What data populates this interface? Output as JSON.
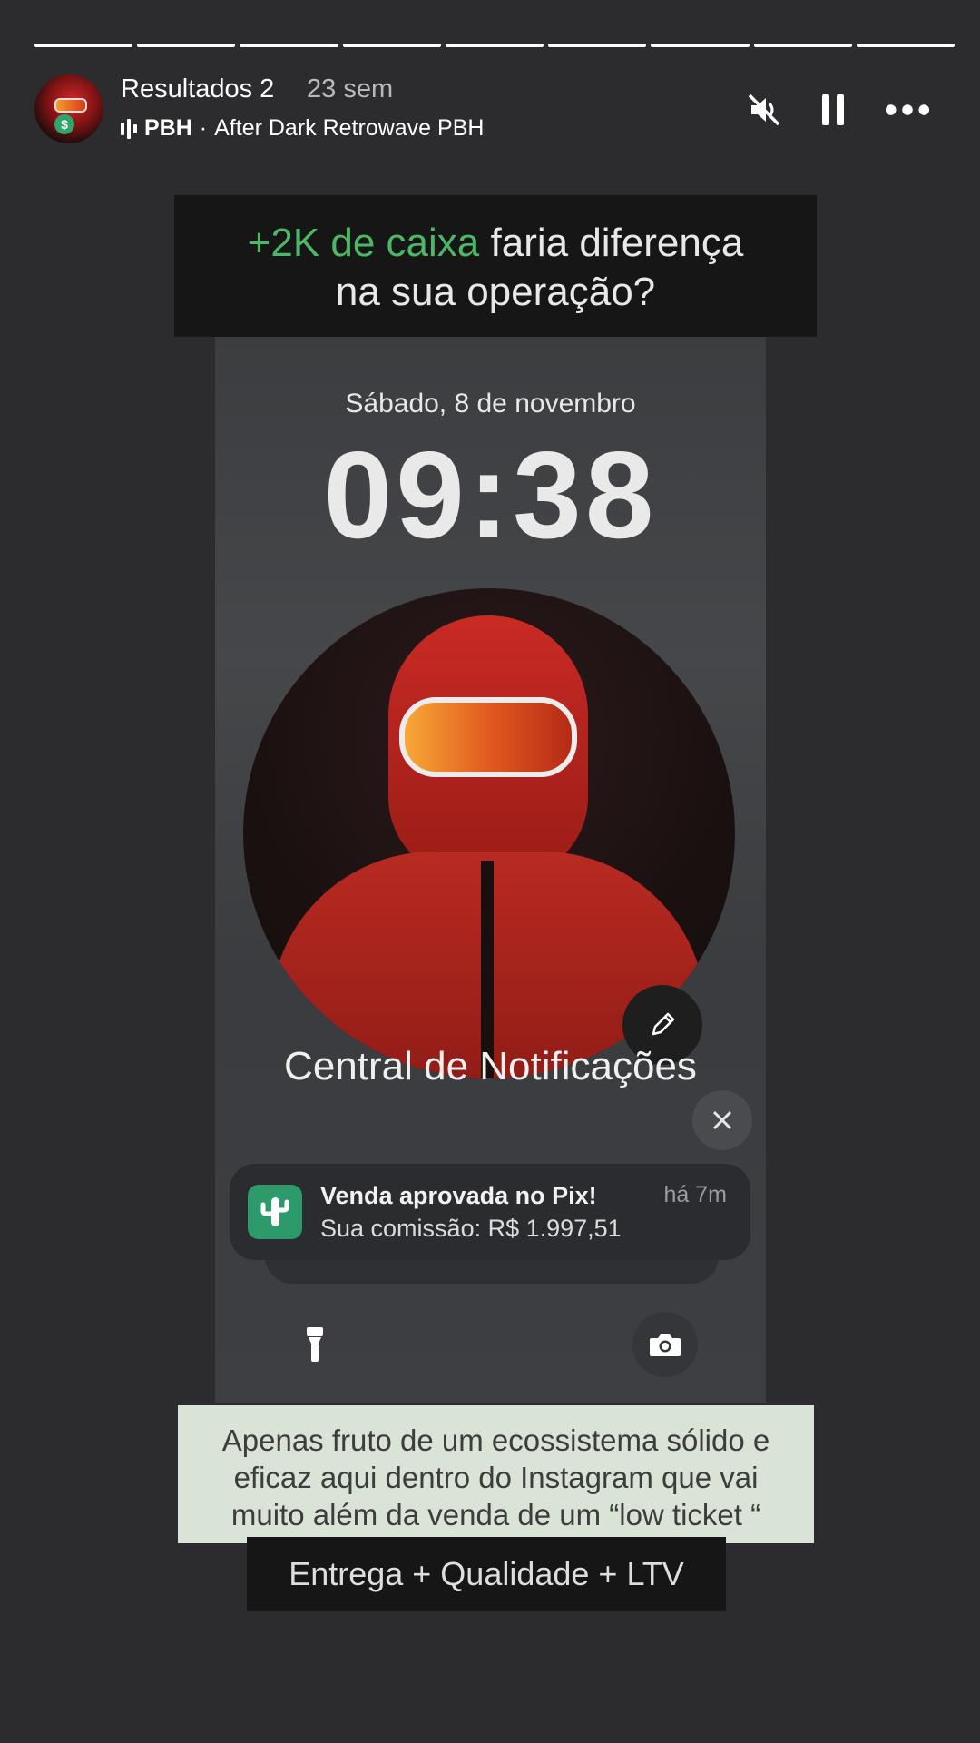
{
  "progress": {
    "segments_total": 9,
    "segments_done": 9
  },
  "header": {
    "account_name": "Resultados 2",
    "posted_ago": "23 sem",
    "music_artist": "PBH",
    "music_separator": "·",
    "music_track": "After Dark Retrowave PBH",
    "icons": [
      "volume-muted-icon",
      "pause-icon",
      "more-options-icon"
    ]
  },
  "story": {
    "banner_accent": "+2K de caixa",
    "banner_rest_line1": " faria diferença",
    "banner_line2": "na sua operação?",
    "lockscreen": {
      "date": "Sábado, 8 de novembro",
      "time": "09:38",
      "notification_center_title": "Central de Notificações",
      "notification": {
        "title": "Venda aprovada no Pix!",
        "body": "Sua comissão: R$ 1.997,51",
        "time": "há 7m",
        "app_icon": "cactus-app-icon",
        "app_icon_color": "#2c9a6a"
      },
      "bottom_icons": [
        "flashlight-icon",
        "camera-icon"
      ]
    },
    "caption_line1": "Apenas fruto de um ecossistema sólido e",
    "caption_line2": "eficaz aqui dentro do Instagram que vai",
    "caption_line3": "muito além da venda de um “low ticket “",
    "tagline": "Entrega + Qualidade + LTV"
  },
  "colors": {
    "background": "#2c2c2e",
    "accent_green": "#4cb866",
    "caption_bg": "#d9e3d6"
  }
}
